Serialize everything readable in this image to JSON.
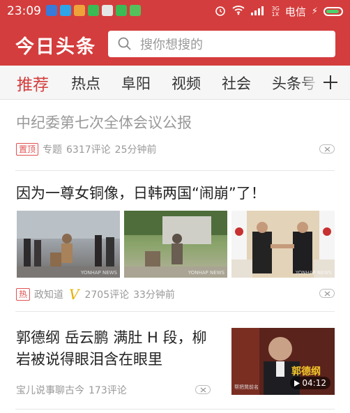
{
  "status_bar": {
    "time": "23:09",
    "network": "3G",
    "network_sub": "1X",
    "carrier": "电信",
    "app_icons": [
      "notification-app-1-icon",
      "notification-app-2-icon",
      "notification-app-3-icon",
      "notification-app-4-icon",
      "notification-app-5-icon",
      "notification-app-6-icon",
      "notification-app-7-icon"
    ]
  },
  "header": {
    "logo": "今日头条",
    "search_placeholder": "搜你想搜的"
  },
  "tabs": [
    {
      "label": "推荐",
      "active": true
    },
    {
      "label": "热点",
      "active": false
    },
    {
      "label": "阜阳",
      "active": false
    },
    {
      "label": "视频",
      "active": false
    },
    {
      "label": "社会",
      "active": false
    },
    {
      "label": "头条号",
      "active": false
    }
  ],
  "articles": [
    {
      "title": "中纪委第七次全体会议公报",
      "tag": "置顶",
      "source": "专题",
      "comments": "6317评论",
      "time": "25分钟前"
    },
    {
      "title": "因为一尊女铜像，日韩两国“闹崩”了！",
      "tag": "热",
      "source": "政知道",
      "verified_mark": "V",
      "comments": "2705评论",
      "time": "33分钟前",
      "image_watermark": "YONHAP NEWS"
    },
    {
      "title_line1": "郭德纲 岳云鹏 满肚 H 段，柳",
      "title_line2": "岩被说得眼泪含在眼里",
      "source": "宝儿说事聊古今",
      "comments": "173评论",
      "duration": "04:12",
      "thumb_caption": "郭德纲",
      "thumb_corner_text": "帮把凳前名"
    }
  ],
  "colors": {
    "brand_red": "#d43d3d",
    "tag_red": "#e05252",
    "verified_gold": "#e5b000"
  }
}
